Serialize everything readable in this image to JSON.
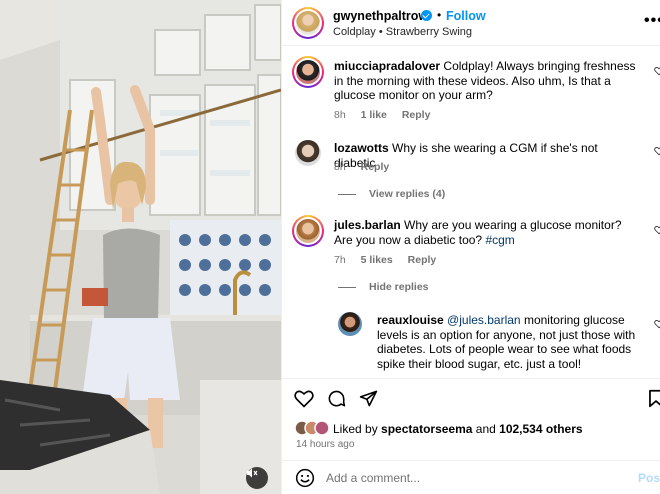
{
  "post": {
    "username": "gwynethpaltrow",
    "separator": "•",
    "follow_label": "Follow",
    "audio_artist": "Coldplay",
    "audio_dot": "•",
    "audio_track": "Strawberry Swing",
    "more_label": "•••"
  },
  "comments": [
    {
      "username": "miucciapradalover",
      "text": "Coldplay! Always bringing freshness in the morning with these videos. Also uhm, Is that a glucose monitor on your arm?",
      "age": "8h",
      "likes": "1 like",
      "reply_label": "Reply"
    },
    {
      "username": "lozawotts",
      "text": "Why is she wearing a CGM if she's not diabetic",
      "age": "8h",
      "reply_label": "Reply",
      "replies_toggle": "View replies (4)"
    },
    {
      "username": "jules.barlan",
      "text": "Why are you wearing a glucose monitor? Are you now a diabetic too?",
      "hashtag": "#cgm",
      "age": "7h",
      "likes": "5 likes",
      "reply_label": "Reply",
      "replies_toggle": "Hide replies"
    },
    {
      "username": "reauxlouise",
      "mention": "@jules.barlan",
      "text": "monitoring glucose levels is an option for anyone, not just those with diabetes. Lots of people wear to see what foods spike their blood sugar, etc. just a tool!"
    }
  ],
  "likes_summary": {
    "prefix": "Liked by",
    "user": "spectatorseema",
    "middle": "and",
    "others": "102,534 others"
  },
  "time_ago": "14 hours ago",
  "composer": {
    "placeholder": "Add a comment...",
    "post_label": "Post"
  },
  "icons": {
    "emoji": "emoji-icon",
    "heart": "heart-icon",
    "comment": "comment-icon",
    "share": "share-icon",
    "save": "bookmark-icon",
    "mute": "speaker-muted-icon",
    "verified": "verified-badge-icon"
  },
  "colors": {
    "link_blue": "#0095f6",
    "mention_blue": "#00376b",
    "meta_gray": "#737373"
  }
}
